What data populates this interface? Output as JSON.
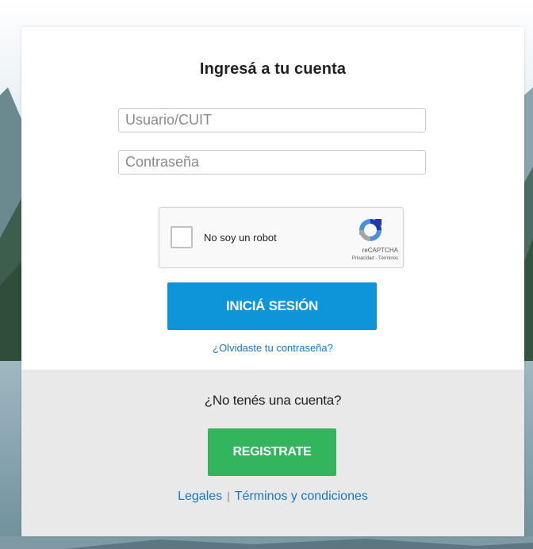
{
  "login": {
    "title": "Ingresá a tu cuenta",
    "username_placeholder": "Usuario/CUIT",
    "password_placeholder": "Contraseña",
    "captcha": {
      "label": "No soy un robot",
      "brand": "reCAPTCHA",
      "links": "Privacidad - Términos"
    },
    "submit_label": "INICIÁ SESIÓN",
    "forgot_password": "¿Olvidaste tu contraseña?"
  },
  "signup": {
    "prompt": "¿No tenés una cuenta?",
    "register_label": "REGISTRATE"
  },
  "footer": {
    "legal_link": "Legales",
    "separator": "|",
    "terms_link": "Términos y condiciones"
  },
  "colors": {
    "primary_button": "#0e94d8",
    "register_button": "#32b55c",
    "link": "#1877c6",
    "bottom_panel": "#e9e9e9"
  }
}
